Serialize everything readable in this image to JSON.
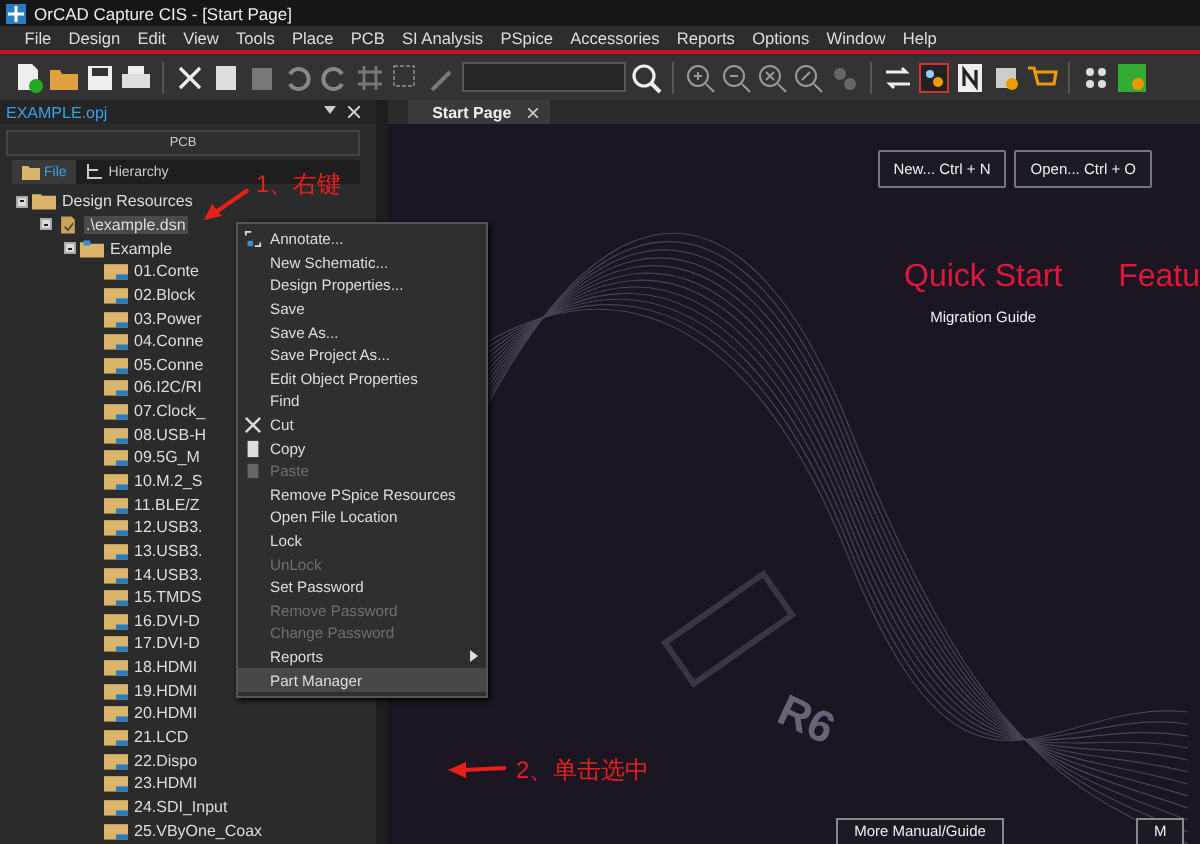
{
  "window": {
    "title": "OrCAD Capture CIS - [Start Page]"
  },
  "menu_bar": [
    "File",
    "Design",
    "Edit",
    "View",
    "Tools",
    "Place",
    "PCB",
    "SI Analysis",
    "PSpice",
    "Accessories",
    "Reports",
    "Options",
    "Window",
    "Help"
  ],
  "project_panel": {
    "title": "EXAMPLE.opj",
    "header": "PCB",
    "tabs": [
      {
        "label": "File",
        "selected": true
      },
      {
        "label": "Hierarchy",
        "selected": false
      }
    ],
    "tree": [
      {
        "label": "Design Resources",
        "kind": "folder",
        "expanded": true,
        "selected": false,
        "children": [
          {
            "label": ".\\example.dsn",
            "kind": "design",
            "expanded": true,
            "selected": true,
            "children": [
              {
                "label": "Example",
                "kind": "schematic",
                "expanded": true,
                "selected": false,
                "children": [
                  {
                    "label": "01.Conte",
                    "kind": "page",
                    "selected": false
                  },
                  {
                    "label": "02.Block",
                    "kind": "page",
                    "selected": false
                  },
                  {
                    "label": "03.Power",
                    "kind": "page",
                    "selected": false
                  },
                  {
                    "label": "04.Conne",
                    "kind": "page",
                    "selected": false
                  },
                  {
                    "label": "05.Conne",
                    "kind": "page",
                    "selected": false
                  },
                  {
                    "label": "06.I2C/RI",
                    "kind": "page",
                    "selected": false
                  },
                  {
                    "label": "07.Clock_",
                    "kind": "page",
                    "selected": false
                  },
                  {
                    "label": "08.USB-H",
                    "kind": "page",
                    "selected": false
                  },
                  {
                    "label": "09.5G_M",
                    "kind": "page",
                    "selected": false
                  },
                  {
                    "label": "10.M.2_S",
                    "kind": "page",
                    "selected": false
                  },
                  {
                    "label": "11.BLE/Z",
                    "kind": "page",
                    "selected": false
                  },
                  {
                    "label": "12.USB3.",
                    "kind": "page",
                    "selected": false
                  },
                  {
                    "label": "13.USB3.",
                    "kind": "page",
                    "selected": false
                  },
                  {
                    "label": "14.USB3.",
                    "kind": "page",
                    "selected": false
                  },
                  {
                    "label": "15.TMDS",
                    "kind": "page",
                    "selected": false
                  },
                  {
                    "label": "16.DVI-D",
                    "kind": "page",
                    "selected": false
                  },
                  {
                    "label": "17.DVI-D",
                    "kind": "page",
                    "selected": false
                  },
                  {
                    "label": "18.HDMI",
                    "kind": "page",
                    "selected": false
                  },
                  {
                    "label": "19.HDMI",
                    "kind": "page",
                    "selected": false
                  },
                  {
                    "label": "20.HDMI",
                    "kind": "page",
                    "selected": false
                  },
                  {
                    "label": "21.LCD",
                    "kind": "page",
                    "selected": false
                  },
                  {
                    "label": "22.Dispo",
                    "kind": "page",
                    "selected": false
                  },
                  {
                    "label": "23.HDMI",
                    "kind": "page",
                    "selected": false
                  },
                  {
                    "label": "24.SDI_Input",
                    "kind": "page",
                    "selected": false
                  },
                  {
                    "label": "25.VByOne_Coax",
                    "kind": "page",
                    "selected": false
                  }
                ]
              }
            ]
          }
        ]
      }
    ]
  },
  "document_tabs": [
    {
      "label": "Start Page",
      "selected": true
    }
  ],
  "start_page": {
    "buttons": [
      "New... Ctrl + N",
      "Open... Ctrl + O"
    ],
    "sections": [
      {
        "title": "Quick Start",
        "links": [
          "Migration Guide"
        ]
      },
      {
        "title": "Featu"
      }
    ],
    "artwork_label": "R6",
    "bottom_buttons": [
      "More Manual/Guide",
      "M"
    ]
  },
  "context_menu": {
    "items": [
      {
        "label": "Annotate...",
        "kind": "annotate",
        "disabled": false,
        "selected": false,
        "submenu": false
      },
      {
        "label": "New Schematic...",
        "kind": "plain",
        "disabled": false,
        "selected": false,
        "submenu": false
      },
      {
        "label": "Design Properties...",
        "kind": "plain",
        "disabled": false,
        "selected": false,
        "submenu": false
      },
      {
        "label": "Save",
        "kind": "plain",
        "disabled": false,
        "selected": false,
        "submenu": false
      },
      {
        "label": "Save As...",
        "kind": "plain",
        "disabled": false,
        "selected": false,
        "submenu": false
      },
      {
        "label": "Save Project As...",
        "kind": "plain",
        "disabled": false,
        "selected": false,
        "submenu": false
      },
      {
        "label": "Edit Object Properties",
        "kind": "plain",
        "disabled": false,
        "selected": false,
        "submenu": false
      },
      {
        "label": "Find",
        "kind": "plain",
        "disabled": false,
        "selected": false,
        "submenu": false
      },
      {
        "label": "Cut",
        "kind": "cut",
        "disabled": false,
        "selected": false,
        "submenu": false
      },
      {
        "label": "Copy",
        "kind": "copy",
        "disabled": false,
        "selected": false,
        "submenu": false
      },
      {
        "label": "Paste",
        "kind": "paste",
        "disabled": true,
        "selected": false,
        "submenu": false
      },
      {
        "label": "Remove PSpice Resources",
        "kind": "plain",
        "disabled": false,
        "selected": false,
        "submenu": false
      },
      {
        "label": "Open File Location",
        "kind": "plain",
        "disabled": false,
        "selected": false,
        "submenu": false
      },
      {
        "label": "Lock",
        "kind": "plain",
        "disabled": false,
        "selected": false,
        "submenu": false
      },
      {
        "label": "UnLock",
        "kind": "plain",
        "disabled": true,
        "selected": false,
        "submenu": false
      },
      {
        "label": "Set Password",
        "kind": "plain",
        "disabled": false,
        "selected": false,
        "submenu": false
      },
      {
        "label": "Remove Password",
        "kind": "plain",
        "disabled": true,
        "selected": false,
        "submenu": false
      },
      {
        "label": "Change Password",
        "kind": "plain",
        "disabled": true,
        "selected": false,
        "submenu": false
      },
      {
        "label": "Reports",
        "kind": "plain",
        "disabled": false,
        "selected": false,
        "submenu": true
      },
      {
        "label": "Part Manager",
        "kind": "plain",
        "disabled": false,
        "selected": true,
        "submenu": false
      }
    ]
  },
  "annotations": [
    {
      "text": "1、右键"
    },
    {
      "text": "2、单击选中"
    }
  ]
}
